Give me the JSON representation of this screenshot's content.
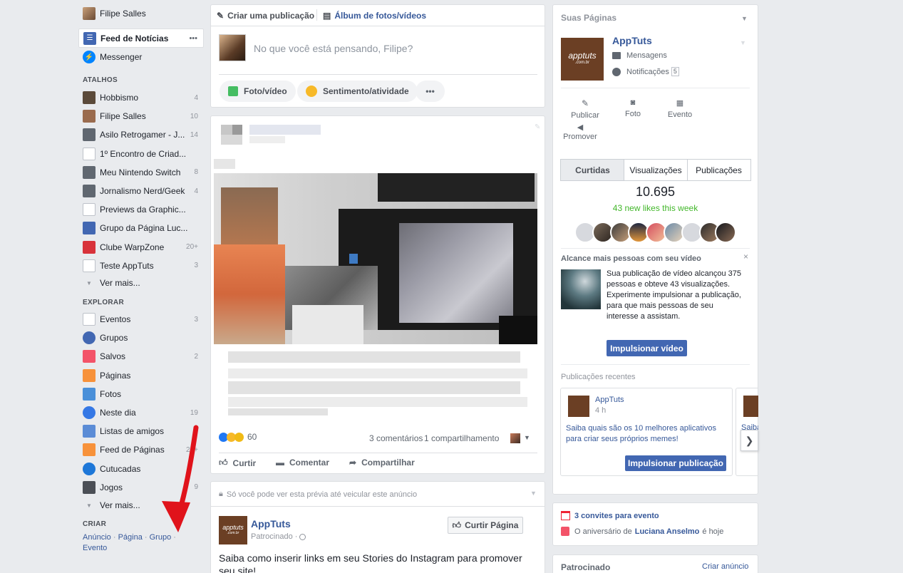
{
  "left": {
    "user_name": "Filipe Salles",
    "feed_label": "Feed de Notícias",
    "feed_more": "•••",
    "messenger_label": "Messenger",
    "shortcuts_title": "ATALHOS",
    "shortcuts": [
      {
        "label": "Hobbismo",
        "count": "4"
      },
      {
        "label": "Filipe Salles",
        "count": "10"
      },
      {
        "label": "Asilo Retrogamer - J...",
        "count": "14"
      },
      {
        "label": "1º Encontro de Criad...",
        "count": ""
      },
      {
        "label": "Meu Nintendo Switch",
        "count": "8"
      },
      {
        "label": "Jornalismo Nerd/Geek",
        "count": "4"
      },
      {
        "label": "Previews da Graphic...",
        "count": ""
      },
      {
        "label": "Grupo da Página Luc...",
        "count": ""
      },
      {
        "label": "Clube WarpZone",
        "count": "20+"
      },
      {
        "label": "Teste AppTuts",
        "count": "3"
      }
    ],
    "see_more": "Ver mais...",
    "explore_title": "EXPLORAR",
    "explore": [
      {
        "label": "Eventos",
        "count": "3"
      },
      {
        "label": "Grupos",
        "count": ""
      },
      {
        "label": "Salvos",
        "count": "2"
      },
      {
        "label": "Páginas",
        "count": ""
      },
      {
        "label": "Fotos",
        "count": ""
      },
      {
        "label": "Neste dia",
        "count": "19"
      },
      {
        "label": "Listas de amigos",
        "count": ""
      },
      {
        "label": "Feed de Páginas",
        "count": "20+"
      },
      {
        "label": "Cutucadas",
        "count": ""
      },
      {
        "label": "Jogos",
        "count": "9"
      }
    ],
    "see_more_2": "Ver mais...",
    "create_title": "CRIAR",
    "create_links": [
      "Anúncio",
      "Página",
      "Grupo",
      "Evento"
    ],
    "create_sep": "·"
  },
  "composer": {
    "tab_create": "Criar uma publicação",
    "tab_album": "Álbum de fotos/vídeos",
    "placeholder": "No que você está pensando, Filipe?",
    "btn_photo": "Foto/vídeo",
    "btn_feeling": "Sentimento/atividade",
    "btn_more": "•••"
  },
  "post": {
    "reactions_count": "60",
    "comments": "3 comentários",
    "shares": "1 compartilhamento",
    "like": "Curtir",
    "comment": "Comentar",
    "share": "Compartilhar"
  },
  "ad": {
    "notice": "Só você pode ver esta prévia até veicular este anúncio",
    "page_name": "AppTuts",
    "sponsored": "Patrocinado",
    "like_page": "Curtir Página",
    "text": "Saiba como inserir links em seu Stories do Instagram para promover seu site!"
  },
  "right": {
    "pages_title": "Suas Páginas",
    "page_name": "AppTuts",
    "messages": "Mensagens",
    "notifications": "Notificações",
    "notif_count": "5",
    "act_publish": "Publicar",
    "act_photo": "Foto",
    "act_event": "Evento",
    "act_promote": "Promover",
    "tabs": [
      "Curtidas",
      "Visualizações",
      "Publicações"
    ],
    "likes_total": "10.695",
    "new_likes": "43 new likes this week",
    "reach_title": "Alcance mais pessoas com seu vídeo",
    "reach_text": "Sua publicação de vídeo alcançou 375 pessoas e obteve 43 visualizações. Experimente impulsionar a publicação, para que mais pessoas de seu interesse a assistam.",
    "boost_video": "Impulsionar vídeo",
    "recent_title": "Publicações recentes",
    "recent_name": "AppTuts",
    "recent_time": "4 h",
    "recent_text": "Saiba quais são os 10 melhores aplicativos para criar seus próprios memes!",
    "recent_peek": "Saiba",
    "boost_post": "Impulsionar publicação",
    "logo_text": "apptuts",
    "logo_sub": ".com.br"
  },
  "events": {
    "invites": "3 convites para evento",
    "bday_prefix": "O aniversário de",
    "bday_name": "Luciana Anselmo",
    "bday_suffix": "é hoje"
  },
  "sponsored": {
    "title": "Patrocinado",
    "create_ad": "Criar anúncio"
  },
  "colors": {
    "link": "#365899",
    "green": "#42b72a",
    "blue_btn": "#4267b2",
    "arrow": "#e0131b",
    "logo_bg": "#6b3f24"
  }
}
